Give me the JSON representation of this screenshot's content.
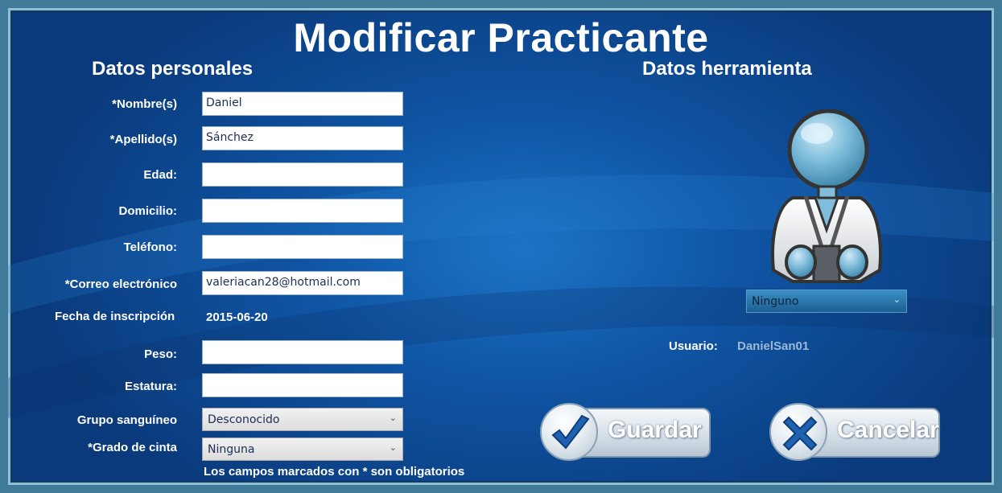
{
  "page": {
    "title": "Modificar Practicante"
  },
  "personal": {
    "heading": "Datos personales",
    "nombre": {
      "label": "*Nombre(s)",
      "value": "Daniel"
    },
    "apellido": {
      "label": "*Apellido(s)",
      "value": "Sánchez"
    },
    "edad": {
      "label": "Edad:",
      "value": ""
    },
    "domicilio": {
      "label": "Domicilio:",
      "value": ""
    },
    "telefono": {
      "label": "Teléfono:",
      "value": ""
    },
    "correo": {
      "label": "*Correo electrónico",
      "value": "valeriacan28@hotmail.com"
    },
    "fecha": {
      "label": "Fecha de inscripción",
      "value": "2015-06-20"
    },
    "peso": {
      "label": "Peso:",
      "value": ""
    },
    "estatura": {
      "label": "Estatura:",
      "value": ""
    },
    "grupo": {
      "label": "Grupo sanguíneo",
      "selected": "Desconocido"
    },
    "grado": {
      "label": "*Grado de cinta",
      "selected": "Ninguna"
    },
    "note": "Los campos marcados con * son obligatorios"
  },
  "tool": {
    "heading": "Datos herramienta",
    "avatar_icon": "karate-person-icon",
    "selected": "Ninguno",
    "usuario_label": "Usuario:",
    "usuario_value": "DanielSan01"
  },
  "buttons": {
    "guardar": {
      "label": "Guardar",
      "icon": "checkmark-icon",
      "icon_color": "#1f62b0"
    },
    "cancelar": {
      "label": "Cancelar",
      "icon": "x-icon",
      "icon_color": "#1f62b0"
    }
  },
  "colors": {
    "background": "#0f54a3",
    "frame": "#3f7a98",
    "text": "#ffffff"
  }
}
